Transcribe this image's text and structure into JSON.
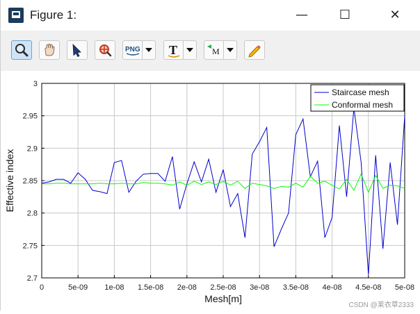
{
  "window": {
    "title": "Figure 1:"
  },
  "controls": {
    "minimize": "—",
    "maximize": "☐",
    "close": "✕"
  },
  "toolbar": {
    "buttons": [
      {
        "name": "zoom",
        "icon": "magnifier-icon",
        "active": true
      },
      {
        "name": "pan",
        "icon": "hand-icon"
      },
      {
        "name": "select",
        "icon": "arrow-cursor-icon"
      },
      {
        "name": "zoom-region",
        "icon": "target-zoom-icon"
      },
      {
        "name": "export",
        "icon": "png-icon",
        "label": "PNG",
        "dropdown": true
      },
      {
        "name": "text",
        "icon": "text-tool-icon",
        "label": "T",
        "dropdown": true
      },
      {
        "name": "marker",
        "icon": "marker-icon",
        "label": "M",
        "dropdown": true
      },
      {
        "name": "edit",
        "icon": "pencil-icon"
      }
    ]
  },
  "watermark": "CSDN @莱衣草2333",
  "chart_data": {
    "type": "line",
    "xlabel": "Mesh[m]",
    "ylabel": "Effective index",
    "xlim": [
      0,
      5e-08
    ],
    "ylim": [
      2.7,
      3.0
    ],
    "xticks": [
      0,
      5e-09,
      1e-08,
      1.5e-08,
      2e-08,
      2.5e-08,
      3e-08,
      3.5e-08,
      4e-08,
      4.5e-08,
      5e-08
    ],
    "xtick_labels": [
      "0",
      "5e-09",
      "1e-08",
      "1.5e-08",
      "2e-08",
      "2.5e-08",
      "3e-08",
      "3.5e-08",
      "4e-08",
      "4.5e-08",
      "5e-08"
    ],
    "yticks": [
      2.7,
      2.75,
      2.8,
      2.85,
      2.9,
      2.95,
      3.0
    ],
    "ytick_labels": [
      "2.7",
      "2.75",
      "2.8",
      "2.85",
      "2.9",
      "2.95",
      "3"
    ],
    "grid": true,
    "legend_position": "top-right",
    "x": [
      0,
      1e-09,
      2e-09,
      3e-09,
      4e-09,
      5e-09,
      6e-09,
      7e-09,
      8e-09,
      9e-09,
      1e-08,
      1.1e-08,
      1.2e-08,
      1.3e-08,
      1.4e-08,
      1.5e-08,
      1.6e-08,
      1.7e-08,
      1.8e-08,
      1.9e-08,
      2e-08,
      2.1e-08,
      2.2e-08,
      2.3e-08,
      2.4e-08,
      2.5e-08,
      2.6e-08,
      2.7e-08,
      2.8e-08,
      2.9e-08,
      3e-08,
      3.1e-08,
      3.2e-08,
      3.3e-08,
      3.4e-08,
      3.5e-08,
      3.6e-08,
      3.7e-08,
      3.8e-08,
      3.9e-08,
      4e-08,
      4.1e-08,
      4.2e-08,
      4.3e-08,
      4.4e-08,
      4.5e-08,
      4.6e-08,
      4.7e-08,
      4.8e-08,
      4.9e-08,
      5e-08
    ],
    "series": [
      {
        "name": "Staircase mesh",
        "color": "#0000cc",
        "values": [
          2.846,
          2.848,
          2.852,
          2.852,
          2.846,
          2.862,
          2.852,
          2.835,
          2.833,
          2.83,
          2.878,
          2.881,
          2.832,
          2.849,
          2.86,
          2.861,
          2.861,
          2.849,
          2.887,
          2.806,
          2.845,
          2.879,
          2.848,
          2.883,
          2.832,
          2.867,
          2.81,
          2.83,
          2.762,
          2.891,
          2.91,
          2.932,
          2.748,
          2.775,
          2.8,
          2.921,
          2.945,
          2.856,
          2.88,
          2.762,
          2.793,
          2.935,
          2.825,
          2.962,
          2.878,
          2.705,
          2.889,
          2.745,
          2.878,
          2.782,
          2.95
        ]
      },
      {
        "name": "Conformal mesh",
        "color": "#00ff00",
        "values": [
          2.845,
          2.845,
          2.846,
          2.846,
          2.845,
          2.845,
          2.845,
          2.845,
          2.846,
          2.845,
          2.845,
          2.846,
          2.845,
          2.845,
          2.847,
          2.846,
          2.846,
          2.845,
          2.843,
          2.848,
          2.843,
          2.849,
          2.844,
          2.848,
          2.844,
          2.849,
          2.843,
          2.849,
          2.838,
          2.846,
          2.844,
          2.842,
          2.838,
          2.841,
          2.84,
          2.846,
          2.84,
          2.857,
          2.846,
          2.849,
          2.843,
          2.837,
          2.852,
          2.835,
          2.86,
          2.832,
          2.858,
          2.838,
          2.843,
          2.842,
          2.838
        ]
      }
    ]
  }
}
